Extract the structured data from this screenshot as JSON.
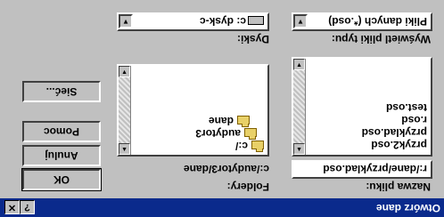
{
  "window": {
    "title": "Otwórz dane",
    "help_btn": "?",
    "close_btn": "✕"
  },
  "file_name": {
    "label": "Nazwa pliku:",
    "value": "r:/dane/przyklad.osd",
    "files": [
      "przyk2.osd",
      "przyklad.osd",
      "r.osd",
      "test.osd"
    ]
  },
  "folders": {
    "label": "Foldery:",
    "path": "c:/audytor3/dane",
    "tree": [
      "c:/",
      "audytor3",
      "dane"
    ]
  },
  "file_type": {
    "label": "Wyświetl pliki typu:",
    "value": "Pliki danych (*.osd)"
  },
  "drives": {
    "label": "Dyski:",
    "value": "c: dysk-c"
  },
  "buttons": {
    "ok": "OK",
    "cancel": "Anuluj",
    "help": "Pomoc",
    "network": "Sieć..."
  }
}
